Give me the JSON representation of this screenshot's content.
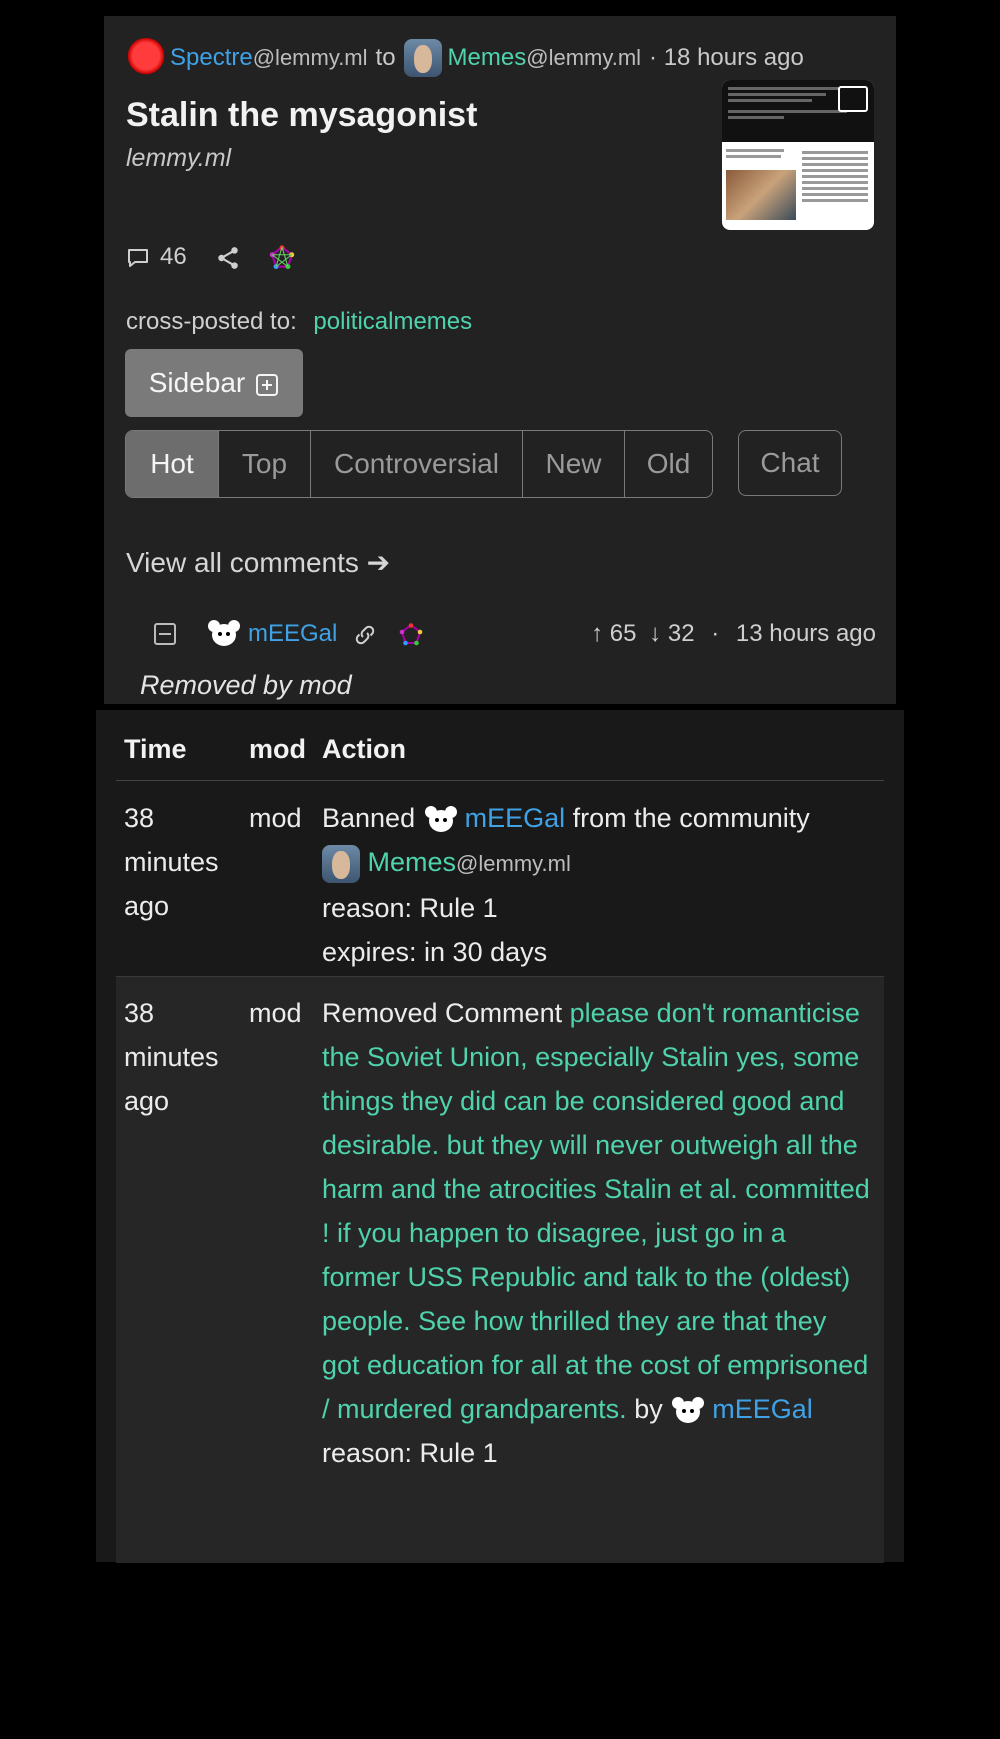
{
  "post": {
    "author": "Spectre",
    "author_instance": "@lemmy.ml",
    "to_word": "to",
    "community": "Memes",
    "community_instance": "@lemmy.ml",
    "time": "· 18 hours ago",
    "title": "Stalin the mysagonist",
    "domain": "lemmy.ml",
    "comment_count": "46",
    "crosspost_label": "cross-posted to:",
    "crosspost_target": "politicalmemes",
    "sidebar_label": "Sidebar",
    "sort_tabs": [
      "Hot",
      "Top",
      "Controversial",
      "New",
      "Old"
    ],
    "chat_label": "Chat",
    "view_all_label": "View all comments ➔"
  },
  "comment": {
    "author": "mEEGal",
    "upvotes": "65",
    "downvotes": "32",
    "time": "13 hours ago",
    "body": "Removed by mod"
  },
  "modlog": {
    "headers": [
      "Time",
      "mod",
      "Action"
    ],
    "rows": [
      {
        "time": "38 minutes ago",
        "mod": "mod",
        "action_prefix": "Banned",
        "user": "mEEGal",
        "action_suffix": "from the community",
        "community": "Memes",
        "community_instance": "@lemmy.ml",
        "reason": "reason: Rule 1",
        "expires": "expires: in 30 days"
      },
      {
        "time": "38 minutes ago",
        "mod": "mod",
        "action_prefix": "Removed Comment",
        "comment_text": "please don't romanticise the Soviet Union, especially Stalin yes, some things they did can be considered good and desirable. but they will never outweigh all the harm and the atrocities Stalin et al. committed ! if you happen to disagree, just go in a former USS Republic and talk to the (oldest) people. See how thrilled they are that they got education for all at the cost of emprisoned / murdered grandparents.",
        "by_word": "by",
        "user": "mEEGal",
        "reason": "reason: Rule 1"
      }
    ]
  },
  "colors": {
    "user_link": "#3fa2e6",
    "community_link": "#4fd3ad",
    "card_bg": "#222222"
  }
}
